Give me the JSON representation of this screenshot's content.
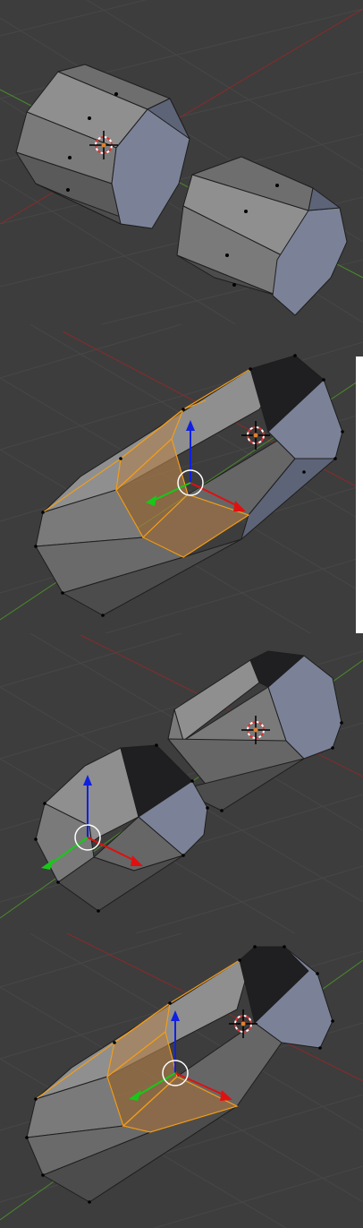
{
  "viewports": [
    {
      "name": "viewport-1",
      "description_hidden": ""
    },
    {
      "name": "viewport-2"
    },
    {
      "name": "viewport-3"
    },
    {
      "name": "viewport-4"
    }
  ],
  "colors": {
    "background": "#3d3d3d",
    "grid": "#474747",
    "x_axis": "#8a2a2a",
    "y_axis": "#4a8a2a",
    "mesh_light": "#8f8f8f",
    "mesh_mid": "#6e6e6e",
    "mesh_dark": "#4c4c4c",
    "mesh_blue": "#7b8298",
    "mesh_black": "#1f1f22",
    "selection": "#f29d1a",
    "gizmo_x": "#e01010",
    "gizmo_y": "#18c818",
    "gizmo_z": "#1020e0"
  },
  "icons": [
    "3d-cursor-icon",
    "transform-gizmo-icon"
  ]
}
